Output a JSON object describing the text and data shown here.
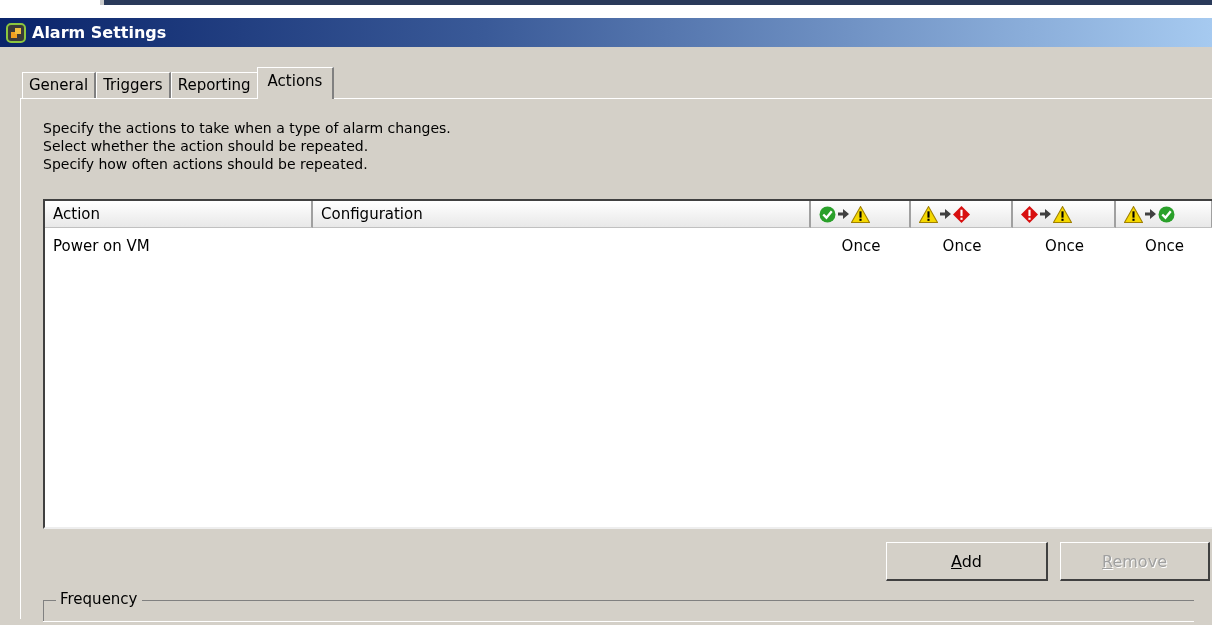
{
  "window": {
    "title": "Alarm Settings"
  },
  "tabs": [
    {
      "label": "General",
      "selected": false
    },
    {
      "label": "Triggers",
      "selected": false
    },
    {
      "label": "Reporting",
      "selected": false
    },
    {
      "label": "Actions",
      "selected": true
    }
  ],
  "description": [
    "Specify the actions to take when a type of alarm changes.",
    "Select whether the action should be repeated.",
    "Specify how often actions should be repeated."
  ],
  "table": {
    "columns": [
      {
        "kind": "text",
        "label": "Action"
      },
      {
        "kind": "text",
        "label": "Configuration"
      },
      {
        "kind": "transition",
        "icons": [
          {
            "kind": "ok"
          },
          {
            "kind": "arrow"
          },
          {
            "kind": "warning"
          }
        ]
      },
      {
        "kind": "transition",
        "icons": [
          {
            "kind": "warning"
          },
          {
            "kind": "arrow"
          },
          {
            "kind": "alert"
          }
        ]
      },
      {
        "kind": "transition",
        "icons": [
          {
            "kind": "alert"
          },
          {
            "kind": "arrow"
          },
          {
            "kind": "warning"
          }
        ]
      },
      {
        "kind": "transition",
        "icons": [
          {
            "kind": "warning"
          },
          {
            "kind": "arrow"
          },
          {
            "kind": "ok"
          }
        ]
      }
    ],
    "rows": [
      [
        "Power on VM",
        "",
        "Once",
        "Once",
        "Once",
        "Once"
      ]
    ]
  },
  "buttons": [
    {
      "label": "Add",
      "disabled": false
    },
    {
      "label": "Remove",
      "disabled": true
    }
  ],
  "frequency": {
    "title": "Frequency"
  }
}
